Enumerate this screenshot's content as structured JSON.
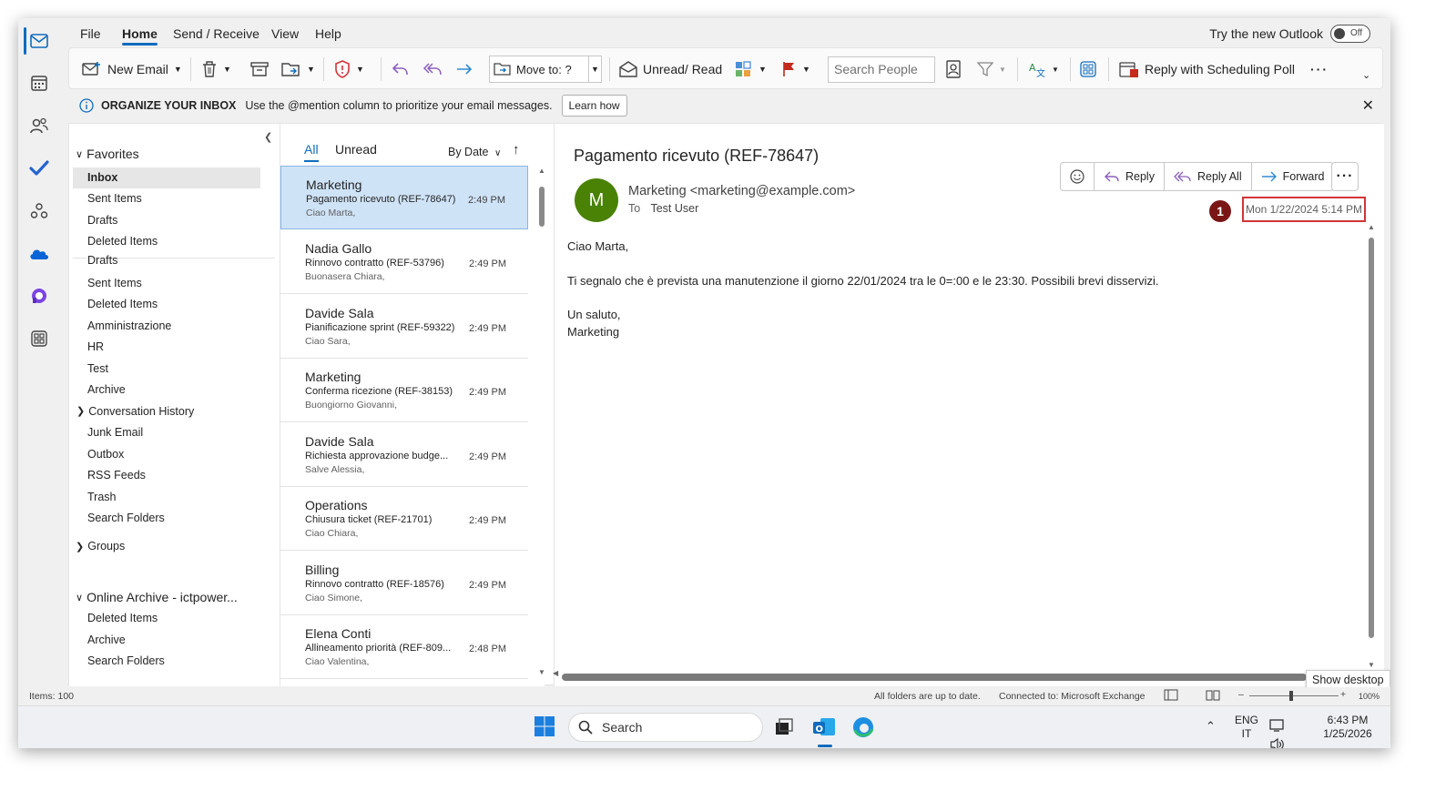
{
  "menu": {
    "items": [
      "File",
      "Home",
      "Send / Receive",
      "View",
      "Help"
    ],
    "active": "Home"
  },
  "try_new": {
    "label": "Try the new Outlook",
    "toggle": "Off"
  },
  "ribbon": {
    "new_email": "New Email",
    "move_to": "Move to: ?",
    "unread_read": "Unread/ Read",
    "search_people_placeholder": "Search People",
    "scheduling_poll": "Reply with Scheduling Poll"
  },
  "infobar": {
    "title": "ORGANIZE YOUR INBOX",
    "message": "Use the @mention column to prioritize your email messages.",
    "learn_how": "Learn how"
  },
  "folders": {
    "favorites": "Favorites",
    "fav_items": [
      "Inbox",
      "Sent Items",
      "Drafts",
      "Deleted Items"
    ],
    "items": [
      "Drafts",
      "Sent Items",
      "Deleted Items",
      "Amministrazione",
      "HR",
      "Test",
      "Archive",
      "Conversation History",
      "Junk Email",
      "Outbox",
      "RSS Feeds",
      "Trash",
      "Search Folders"
    ],
    "groups": "Groups",
    "archive_head": "Online Archive - ictpower...",
    "archive_items": [
      "Deleted Items",
      "Archive",
      "Search Folders"
    ]
  },
  "list": {
    "tab_all": "All",
    "tab_unread": "Unread",
    "sort": "By Date",
    "messages": [
      {
        "sender": "Marketing",
        "subject": "Pagamento ricevuto (REF-78647)",
        "preview": "Ciao Marta,",
        "time": "2:49 PM"
      },
      {
        "sender": "Nadia Gallo",
        "subject": "Rinnovo contratto (REF-53796)",
        "preview": "Buonasera Chiara,",
        "time": "2:49 PM"
      },
      {
        "sender": "Davide Sala",
        "subject": "Pianificazione sprint (REF-59322)",
        "preview": "Ciao Sara,",
        "time": "2:49 PM"
      },
      {
        "sender": "Marketing",
        "subject": "Conferma ricezione (REF-38153)",
        "preview": "Buongiorno Giovanni,",
        "time": "2:49 PM"
      },
      {
        "sender": "Davide Sala",
        "subject": "Richiesta approvazione budge...",
        "preview": "Salve Alessia,",
        "time": "2:49 PM"
      },
      {
        "sender": "Operations",
        "subject": "Chiusura ticket (REF-21701)",
        "preview": "Ciao Chiara,",
        "time": "2:49 PM"
      },
      {
        "sender": "Billing",
        "subject": "Rinnovo contratto (REF-18576)",
        "preview": "Ciao Simone,",
        "time": "2:49 PM"
      },
      {
        "sender": "Elena Conti",
        "subject": "Allineamento priorità (REF-809...",
        "preview": "Ciao Valentina,",
        "time": "2:48 PM"
      }
    ]
  },
  "reading": {
    "subject": "Pagamento ricevuto (REF-78647)",
    "avatar_letter": "M",
    "from": "Marketing <marketing@example.com>",
    "to_label": "To",
    "to": "Test User",
    "reply": "Reply",
    "reply_all": "Reply All",
    "forward": "Forward",
    "date": "Mon 1/22/2024 5:14 PM",
    "callout": "1",
    "body": {
      "greeting": "Ciao Marta,",
      "paragraph": "Ti segnalo che è prevista una manutenzione il giorno 22/01/2024 tra le 0=:00 e le 23:30. Possibili brevi disservizi.",
      "closing1": "Un saluto,",
      "closing2": "Marketing"
    }
  },
  "status": {
    "items": "Items: 100",
    "up_to_date": "All folders are up to date.",
    "connected": "Connected to: Microsoft Exchange",
    "zoom": "100%",
    "show_desktop": "Show desktop"
  },
  "taskbar": {
    "search": "Search",
    "lang1": "ENG",
    "lang2": "IT",
    "time": "6:43 PM",
    "date": "1/25/2026"
  },
  "colors": {
    "accent": "#0f6cbd",
    "avatar": "#498205",
    "highlight": "#d13438",
    "selected_row": "#cfe3f7"
  }
}
